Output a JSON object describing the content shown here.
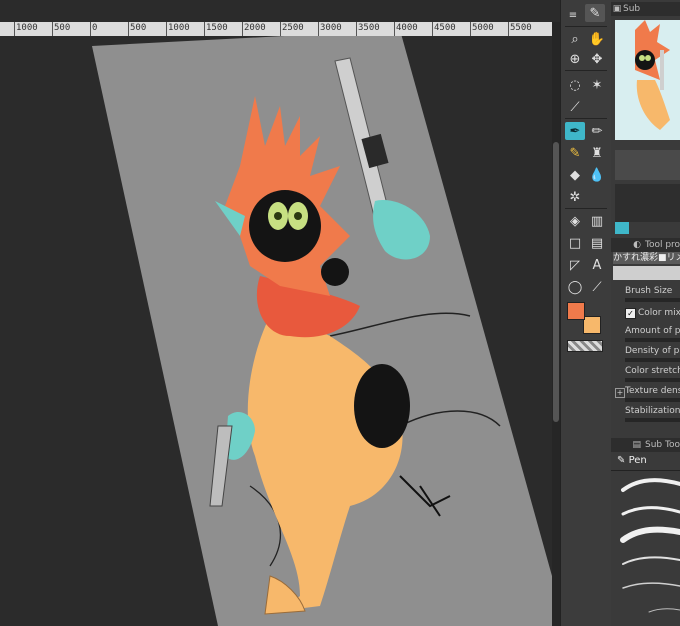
{
  "ruler": {
    "labels": [
      "1000",
      "500",
      "0",
      "500",
      "1000",
      "1500",
      "2000",
      "2500",
      "3000",
      "3500",
      "4000",
      "4500",
      "5000",
      "5500"
    ]
  },
  "tools": {
    "icons": [
      "zoom-icon",
      "hand-icon",
      "layer-move-icon",
      "move-icon",
      "lasso-icon",
      "auto-select-icon",
      "eyedropper-icon",
      "pen-icon",
      "pencil-icon",
      "brush-icon",
      "airbrush-icon",
      "eraser-icon",
      "blend-icon",
      "decoration-icon",
      "fill-icon",
      "gradient-icon",
      "figure-icon",
      "frame-icon",
      "ruler-icon",
      "text-icon",
      "balloon-icon",
      "correction-icon"
    ],
    "active": "pen-icon"
  },
  "colors": {
    "main": "#f07a4b",
    "sub": "#f7b86b"
  },
  "panels": {
    "sub_view_title": "Sub",
    "tool_property_title": "Tool prope",
    "brush_preset": "かすれ濃彩■リメイ",
    "brush_size_label": "Brush Size",
    "color_mixing_label": "Color mixing",
    "amount_label": "Amount of paint",
    "density_label": "Density of paint",
    "stretch_label": "Color stretch",
    "texture_label": "Texture density",
    "stabilization_label": "Stabilization",
    "sub_tool_title": "Sub Tool [",
    "pen_group_label": "Pen"
  }
}
